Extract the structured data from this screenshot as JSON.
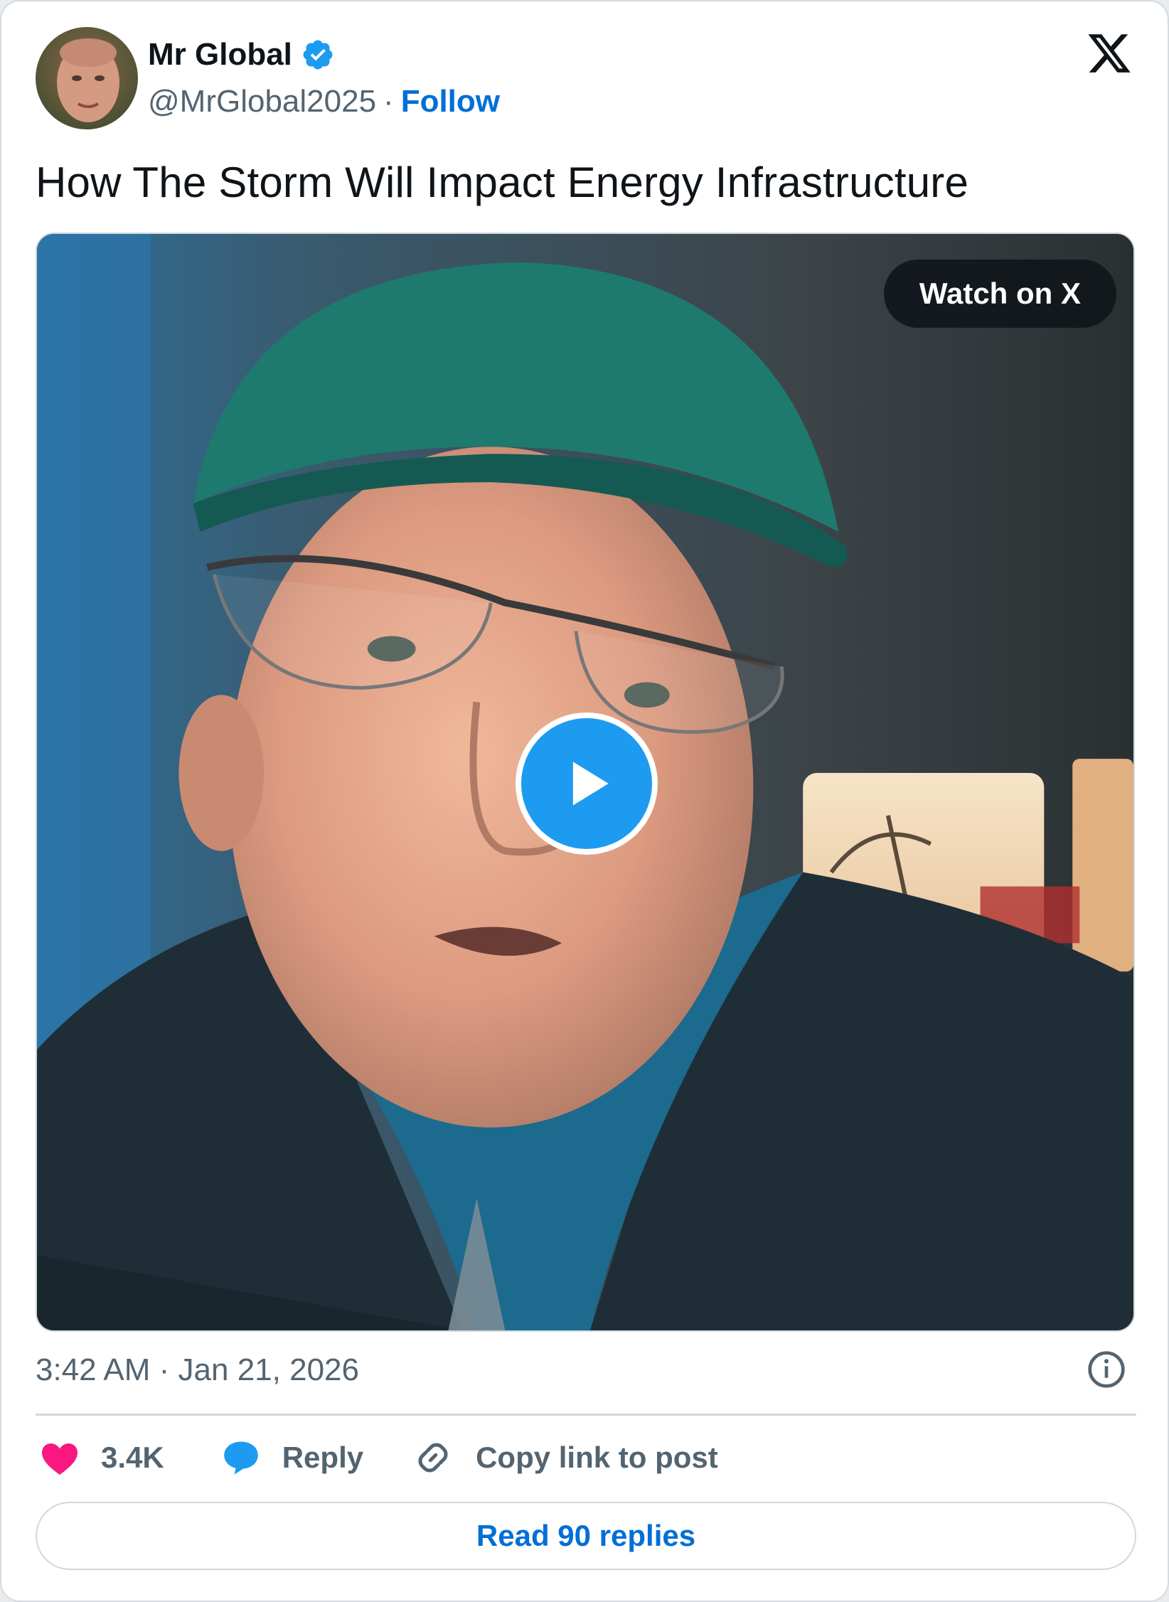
{
  "author": {
    "display_name": "Mr Global",
    "handle": "@MrGlobal2025",
    "separator": "·",
    "follow_label": "Follow",
    "verified": true
  },
  "tweet": {
    "text": "How The Storm Will Impact Energy Infrastructure",
    "timestamp": "3:42 AM · Jan 21, 2026"
  },
  "media": {
    "type": "video",
    "watch_label": "Watch on X"
  },
  "actions": {
    "like_count": "3.4K",
    "reply_label": "Reply",
    "copy_link_label": "Copy link to post"
  },
  "read_replies_label": "Read 90 replies",
  "icons": {
    "brand": "x-logo-icon",
    "verified": "verified-badge-icon",
    "info": "info-icon",
    "like": "heart-icon",
    "reply": "speech-bubble-icon",
    "copy": "link-icon",
    "play": "play-icon"
  },
  "colors": {
    "accent_blue": "#1d9bf0",
    "link_blue": "#006fd6",
    "like_pink": "#f91880",
    "text_primary": "#0f1419",
    "text_secondary": "#536471"
  }
}
